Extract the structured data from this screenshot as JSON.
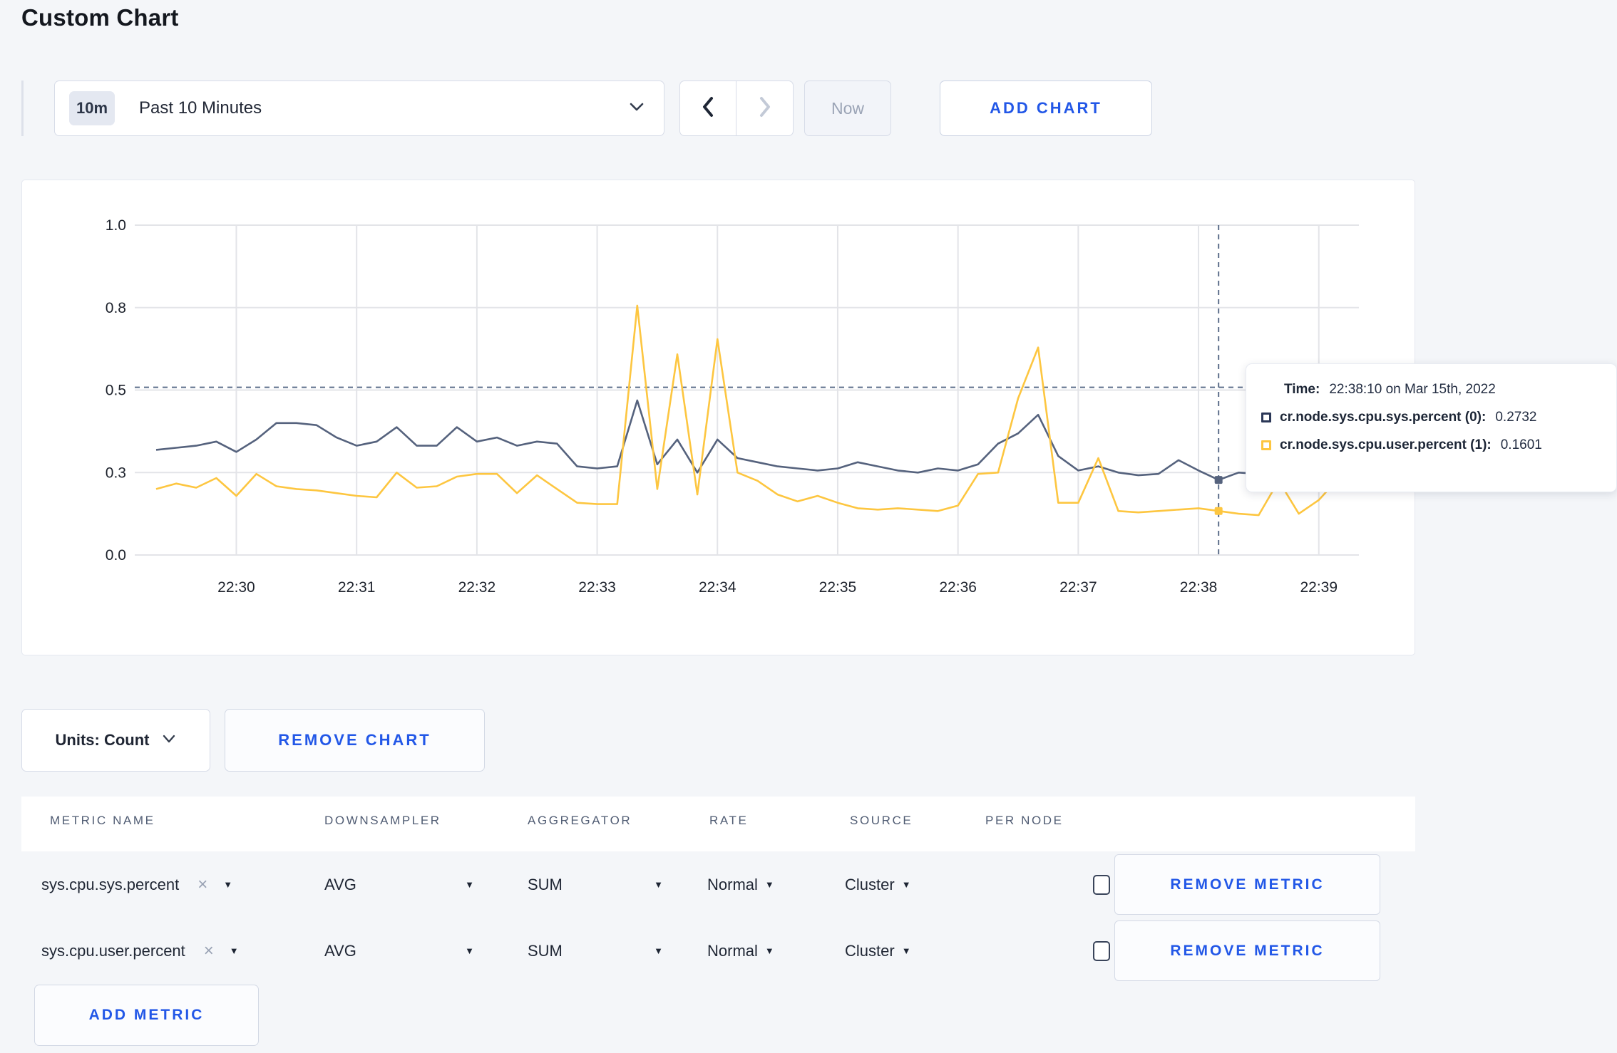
{
  "page": {
    "title": "Custom Chart",
    "background": "#f4f6f9",
    "accent_blue": "#2257e7"
  },
  "toolbar": {
    "time_range": {
      "badge": "10m",
      "label": "Past 10 Minutes"
    },
    "now_label": "Now",
    "add_chart_label": "ADD CHART"
  },
  "chart_data": {
    "type": "line",
    "title": "",
    "xlabel": "",
    "ylabel": "",
    "x_start_time": "22:29:20",
    "sample_interval_sec": 10,
    "x_tick_labels": [
      "22:30",
      "22:31",
      "22:32",
      "22:33",
      "22:34",
      "22:35",
      "22:36",
      "22:37",
      "22:38",
      "22:39"
    ],
    "x_tick_indices": [
      4,
      10,
      16,
      22,
      28,
      34,
      40,
      46,
      52,
      58
    ],
    "y_tick_labels": [
      "0.0",
      "0.3",
      "0.5",
      "0.8",
      "1.0"
    ],
    "y_tick_values": [
      0.0,
      0.3,
      0.5,
      0.8,
      1.0
    ],
    "y_axis_note": "tick labels evenly spaced (piecewise scale)",
    "grid": true,
    "legend_position": "none",
    "series": [
      {
        "name": "cr.node.sys.cpu.sys.percent",
        "color": "#55627D",
        "values": [
          0.355,
          0.36,
          0.365,
          0.375,
          0.35,
          0.38,
          0.42,
          0.42,
          0.415,
          0.385,
          0.365,
          0.375,
          0.41,
          0.365,
          0.365,
          0.41,
          0.375,
          0.385,
          0.365,
          0.375,
          0.37,
          0.315,
          0.31,
          0.315,
          0.475,
          0.32,
          0.38,
          0.3,
          0.38,
          0.335,
          0.325,
          0.315,
          0.31,
          0.305,
          0.31,
          0.325,
          0.315,
          0.305,
          0.3,
          0.31,
          0.305,
          0.32,
          0.37,
          0.395,
          0.44,
          0.34,
          0.305,
          0.315,
          0.3,
          0.29,
          0.295,
          0.33,
          0.305,
          0.2732,
          0.3,
          0.295,
          0.3,
          0.31,
          0.3,
          0.305,
          0.3
        ]
      },
      {
        "name": "cr.node.sys.cpu.user.percent",
        "color": "#FDC640",
        "values": [
          0.24,
          0.26,
          0.245,
          0.28,
          0.215,
          0.295,
          0.25,
          0.24,
          0.235,
          0.225,
          0.215,
          0.21,
          0.3,
          0.245,
          0.25,
          0.285,
          0.295,
          0.295,
          0.225,
          0.29,
          0.24,
          0.19,
          0.185,
          0.185,
          0.805,
          0.24,
          0.63,
          0.22,
          0.685,
          0.3,
          0.27,
          0.22,
          0.195,
          0.215,
          0.19,
          0.17,
          0.165,
          0.17,
          0.165,
          0.16,
          0.18,
          0.295,
          0.3,
          0.48,
          0.655,
          0.19,
          0.19,
          0.335,
          0.16,
          0.155,
          0.16,
          0.165,
          0.17,
          0.1601,
          0.15,
          0.145,
          0.27,
          0.15,
          0.2,
          0.28,
          0.26
        ]
      }
    ],
    "hover": {
      "index": 53,
      "h_guide_value": 0.51,
      "time_label": "Time:",
      "time_value": "22:38:10 on Mar 15th, 2022",
      "rows": [
        {
          "name": "cr.node.sys.cpu.sys.percent (0):",
          "value": "0.2732",
          "color": "#2B3757"
        },
        {
          "name": "cr.node.sys.cpu.user.percent (1):",
          "value": "0.1601",
          "color": "#FDC640"
        }
      ]
    }
  },
  "controls": {
    "units_label": "Units: Count",
    "remove_chart_label": "REMOVE CHART"
  },
  "metrics_table": {
    "headers": [
      "METRIC NAME",
      "DOWNSAMPLER",
      "AGGREGATOR",
      "RATE",
      "SOURCE",
      "PER NODE"
    ],
    "rows": [
      {
        "metric": "sys.cpu.sys.percent",
        "downsampler": "AVG",
        "aggregator": "SUM",
        "rate": "Normal",
        "source": "Cluster",
        "per_node_checked": false,
        "action": "REMOVE METRIC"
      },
      {
        "metric": "sys.cpu.user.percent",
        "downsampler": "AVG",
        "aggregator": "SUM",
        "rate": "Normal",
        "source": "Cluster",
        "per_node_checked": false,
        "action": "REMOVE METRIC"
      }
    ],
    "add_metric_label": "ADD METRIC"
  }
}
